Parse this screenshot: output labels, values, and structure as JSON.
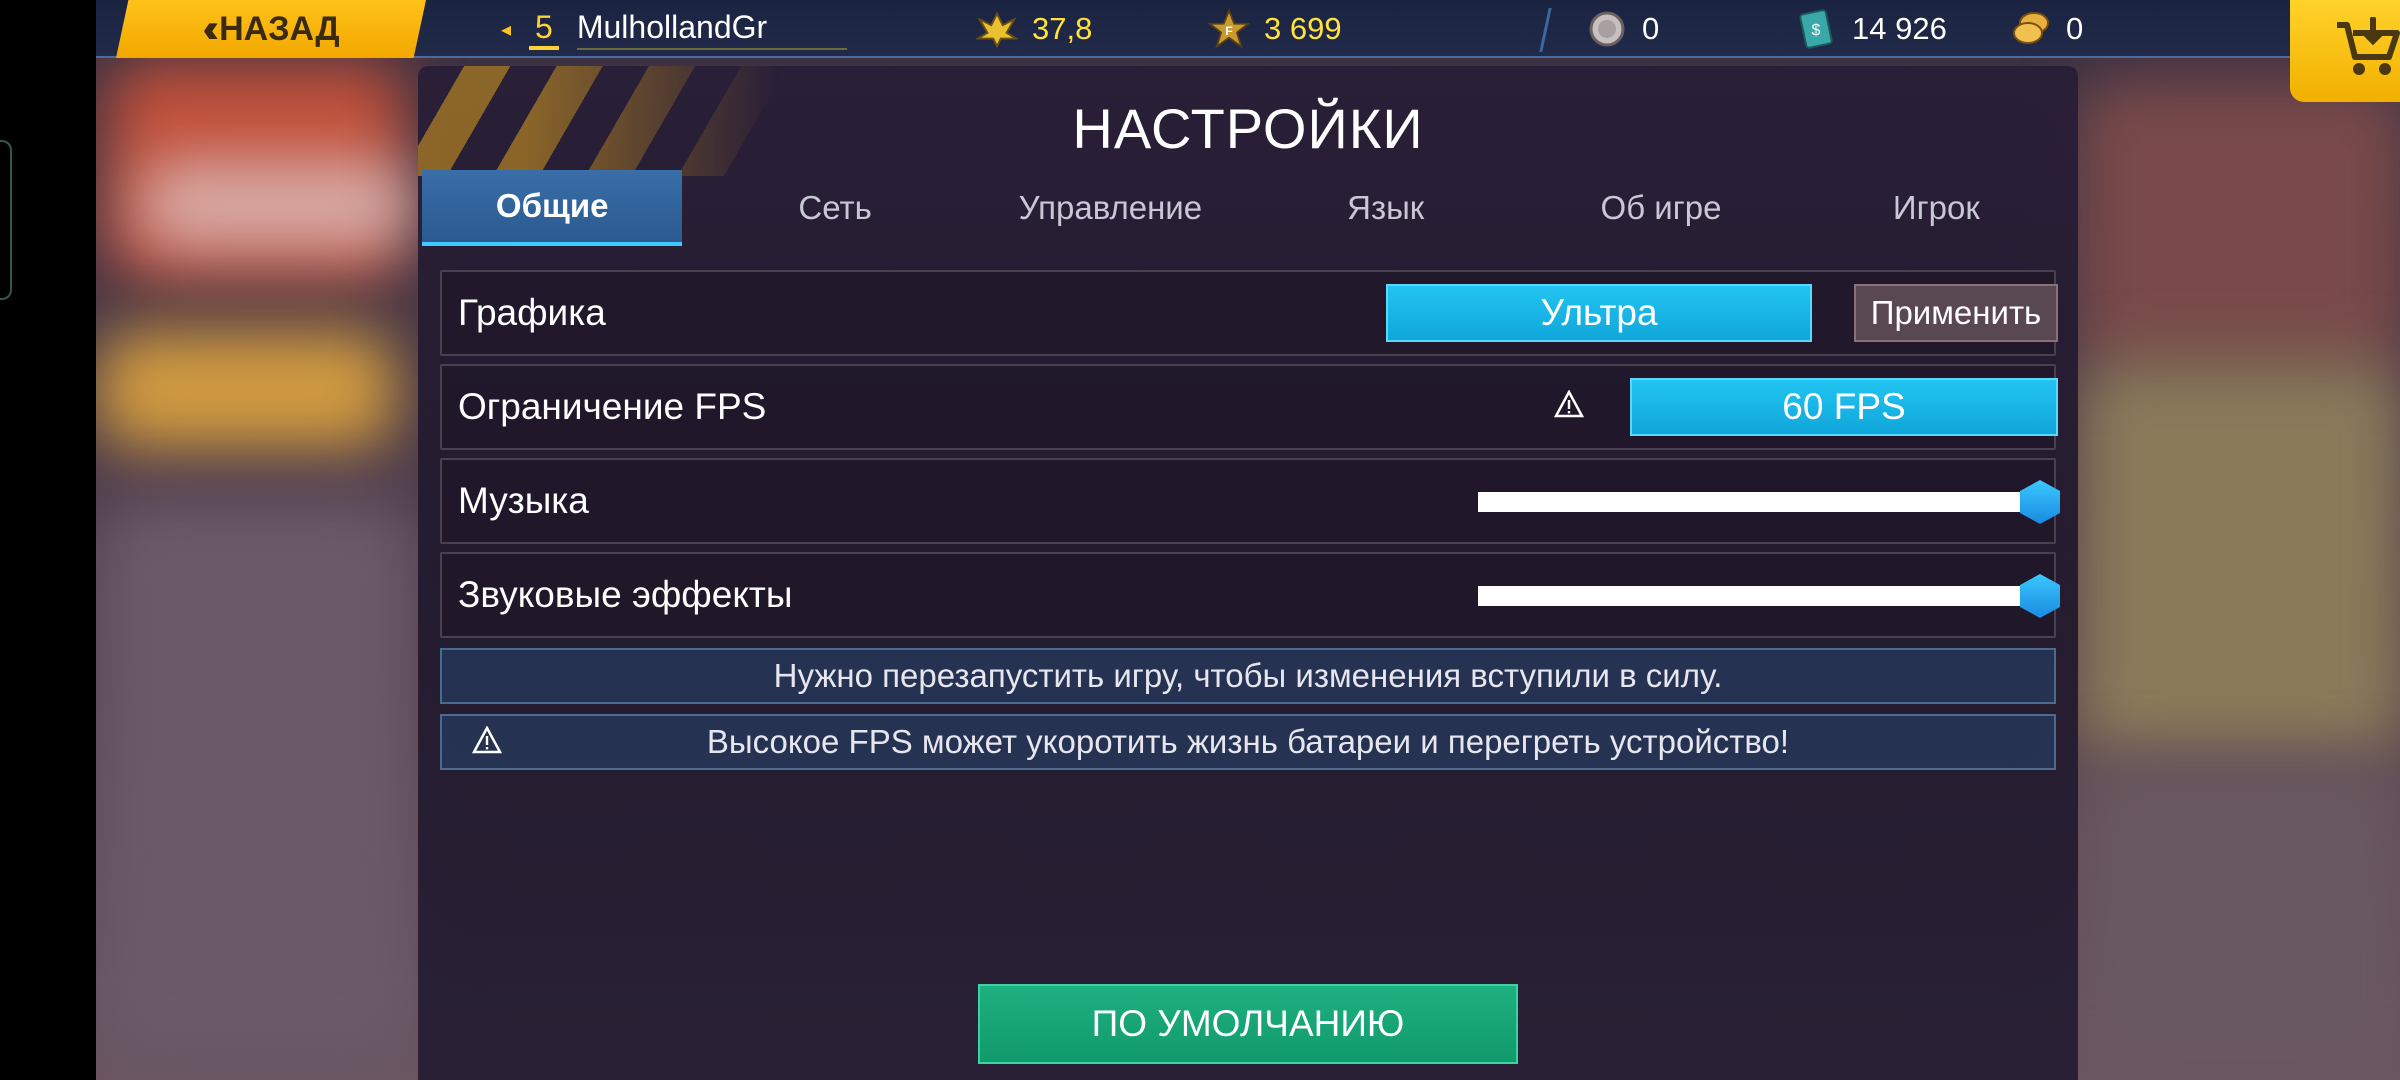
{
  "topbar": {
    "back_label": "НАЗАД",
    "player_level": "5",
    "player_name": "MulhollandGr",
    "stats": [
      {
        "icon": "rank-wings-icon",
        "value": "37,8"
      },
      {
        "icon": "star-badge-icon",
        "value": "3 699"
      },
      {
        "icon": "silver-coin-icon",
        "value": "0"
      },
      {
        "icon": "cash-icon",
        "value": "14 926"
      },
      {
        "icon": "gold-coins-icon",
        "value": "0"
      }
    ],
    "cart_icon": "shopping-cart-icon"
  },
  "settings": {
    "title": "НАСТРОЙКИ",
    "tabs": [
      {
        "label": "Общие",
        "active": true
      },
      {
        "label": "Сеть"
      },
      {
        "label": "Управление"
      },
      {
        "label": "Язык"
      },
      {
        "label": "Об игре"
      },
      {
        "label": "Игрок"
      }
    ],
    "graphics": {
      "label": "Графика",
      "value": "Ультра",
      "apply_label": "Применить"
    },
    "fps": {
      "label": "Ограничение FPS",
      "value": "60 FPS",
      "warning_icon": "warning-icon"
    },
    "music": {
      "label": "Музыка",
      "level": 1.0
    },
    "sfx": {
      "label": "Звуковые эффекты",
      "level": 1.0
    },
    "restart_note": "Нужно перезапустить игру, чтобы изменения вступили в силу.",
    "fps_warning": "Высокое FPS может укоротить жизнь батареи и перегреть устройство!",
    "default_label": "ПО УМОЛЧАНИЮ"
  },
  "colors": {
    "accent_yellow": "#ffc21a",
    "accent_cyan": "#22c4f2",
    "default_green": "#1eb080"
  }
}
